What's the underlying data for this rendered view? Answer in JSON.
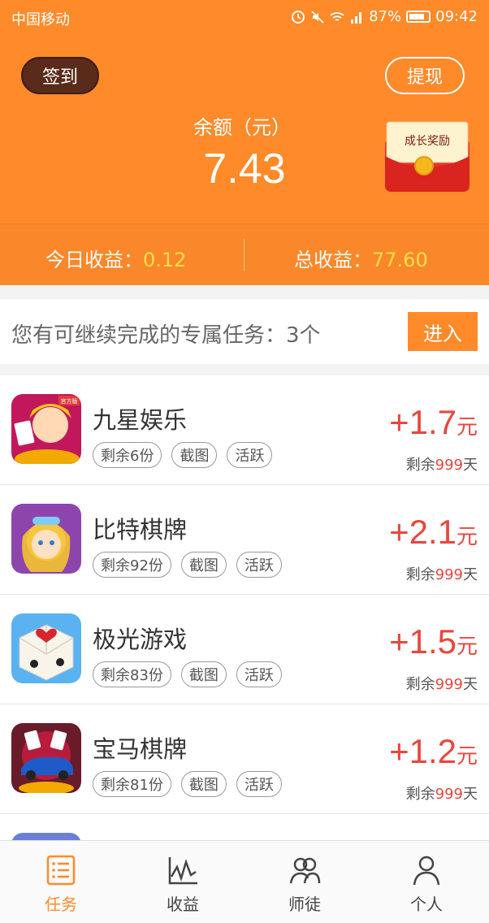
{
  "status_bar": {
    "carrier": "中国移动",
    "battery": "87%",
    "time": "09:42"
  },
  "header": {
    "signin_label": "签到",
    "withdraw_label": "提现",
    "balance_label": "余额（元）",
    "balance_value": "7.43",
    "growth_reward": "成长奖励"
  },
  "stats": {
    "today_label": "今日收益：",
    "today_value": "0.12",
    "total_label": "总收益：",
    "total_value": "77.60"
  },
  "banner": {
    "text": "您有可继续完成的专属任务：3个",
    "button": "进入"
  },
  "tasks": [
    {
      "name": "九星娱乐",
      "remaining": "剩余6份",
      "tag2": "截图",
      "tag3": "活跃",
      "amount": "+1.7",
      "unit": "元",
      "days_prefix": "剩余",
      "days": "999",
      "days_suffix": "天",
      "badge": "官方版"
    },
    {
      "name": "比特棋牌",
      "remaining": "剩余92份",
      "tag2": "截图",
      "tag3": "活跃",
      "amount": "+2.1",
      "unit": "元",
      "days_prefix": "剩余",
      "days": "999",
      "days_suffix": "天"
    },
    {
      "name": "极光游戏",
      "remaining": "剩余83份",
      "tag2": "截图",
      "tag3": "活跃",
      "amount": "+1.5",
      "unit": "元",
      "days_prefix": "剩余",
      "days": "999",
      "days_suffix": "天"
    },
    {
      "name": "宝马棋牌",
      "remaining": "剩余81份",
      "tag2": "截图",
      "tag3": "活跃",
      "amount": "+1.2",
      "unit": "元",
      "days_prefix": "剩余",
      "days": "999",
      "days_suffix": "天"
    }
  ],
  "tabbar": {
    "items": [
      {
        "label": "任务",
        "icon": "list-icon",
        "active": true
      },
      {
        "label": "收益",
        "icon": "chart-icon",
        "active": false
      },
      {
        "label": "师徒",
        "icon": "people-icon",
        "active": false
      },
      {
        "label": "个人",
        "icon": "person-icon",
        "active": false
      }
    ]
  },
  "colors": {
    "accent": "#ff8a2a",
    "reward": "#e8473d",
    "highlight": "#ffe34d"
  }
}
